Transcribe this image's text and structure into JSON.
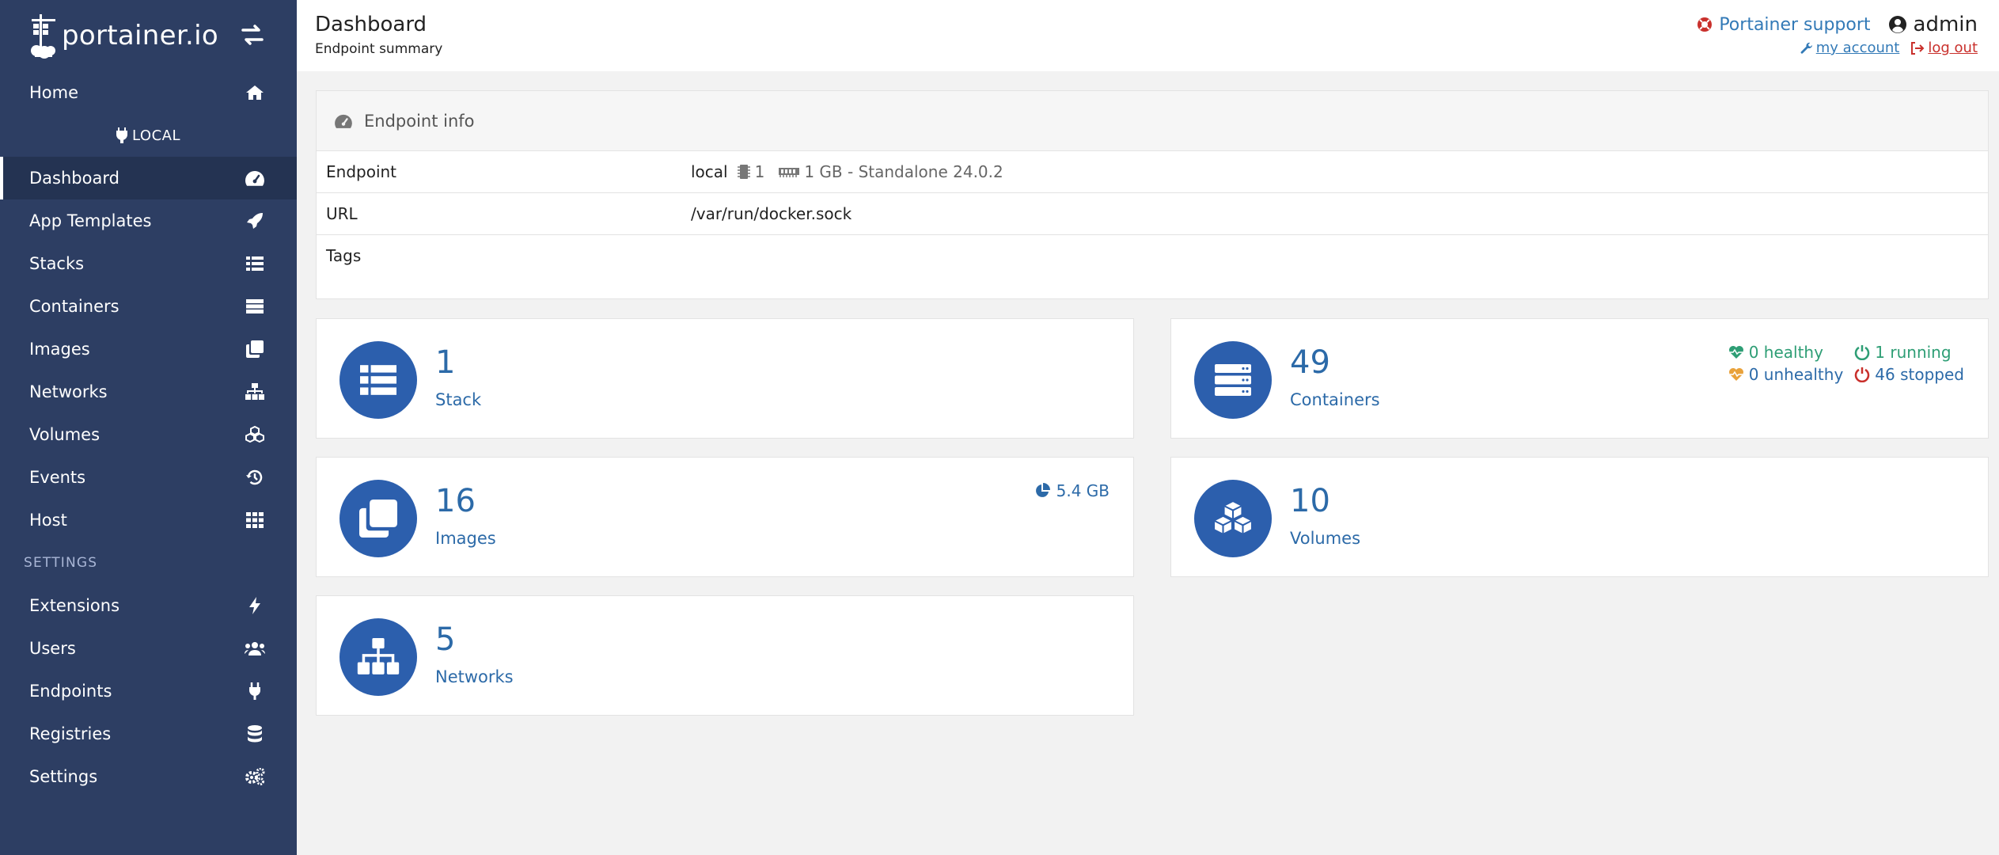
{
  "brand": {
    "name": "portainer.io"
  },
  "sidebar": {
    "home": "Home",
    "endpoint_name": "LOCAL",
    "items": [
      {
        "label": "Dashboard",
        "icon": "tachometer-icon"
      },
      {
        "label": "App Templates",
        "icon": "rocket-icon"
      },
      {
        "label": "Stacks",
        "icon": "list-icon"
      },
      {
        "label": "Containers",
        "icon": "server-icon"
      },
      {
        "label": "Images",
        "icon": "clone-icon"
      },
      {
        "label": "Networks",
        "icon": "sitemap-icon"
      },
      {
        "label": "Volumes",
        "icon": "cubes-icon"
      },
      {
        "label": "Events",
        "icon": "history-icon"
      },
      {
        "label": "Host",
        "icon": "th-icon"
      }
    ],
    "settings_title": "SETTINGS",
    "settings_items": [
      {
        "label": "Extensions",
        "icon": "bolt-icon"
      },
      {
        "label": "Users",
        "icon": "users-icon"
      },
      {
        "label": "Endpoints",
        "icon": "plug-icon"
      },
      {
        "label": "Registries",
        "icon": "database-icon"
      },
      {
        "label": "Settings",
        "icon": "cogs-icon"
      }
    ]
  },
  "header": {
    "title": "Dashboard",
    "subtitle": "Endpoint summary",
    "support": "Portainer support",
    "user": "admin",
    "my_account": "my account",
    "logout": "log out"
  },
  "endpoint_info": {
    "title": "Endpoint info",
    "rows": {
      "endpoint_key": "Endpoint",
      "endpoint_name": "local",
      "cpu": "1",
      "memory": "1 GB - Standalone 24.0.2",
      "url_key": "URL",
      "url_val": "/var/run/docker.sock",
      "tags_key": "Tags"
    }
  },
  "cards": {
    "stack": {
      "count": "1",
      "label": "Stack"
    },
    "containers": {
      "count": "49",
      "label": "Containers",
      "healthy": "0 healthy",
      "running": "1 running",
      "unhealthy": "0 unhealthy",
      "stopped": "46 stopped"
    },
    "images": {
      "count": "16",
      "label": "Images",
      "size": "5.4 GB"
    },
    "volumes": {
      "count": "10",
      "label": "Volumes"
    },
    "networks": {
      "count": "5",
      "label": "Networks"
    }
  },
  "colors": {
    "sidebar": "#2d3e63",
    "accent": "#2c5fad",
    "link": "#337ab7",
    "healthy": "#2e9e75",
    "unhealthy": "#e9a23b",
    "stopped": "#c9302c"
  }
}
